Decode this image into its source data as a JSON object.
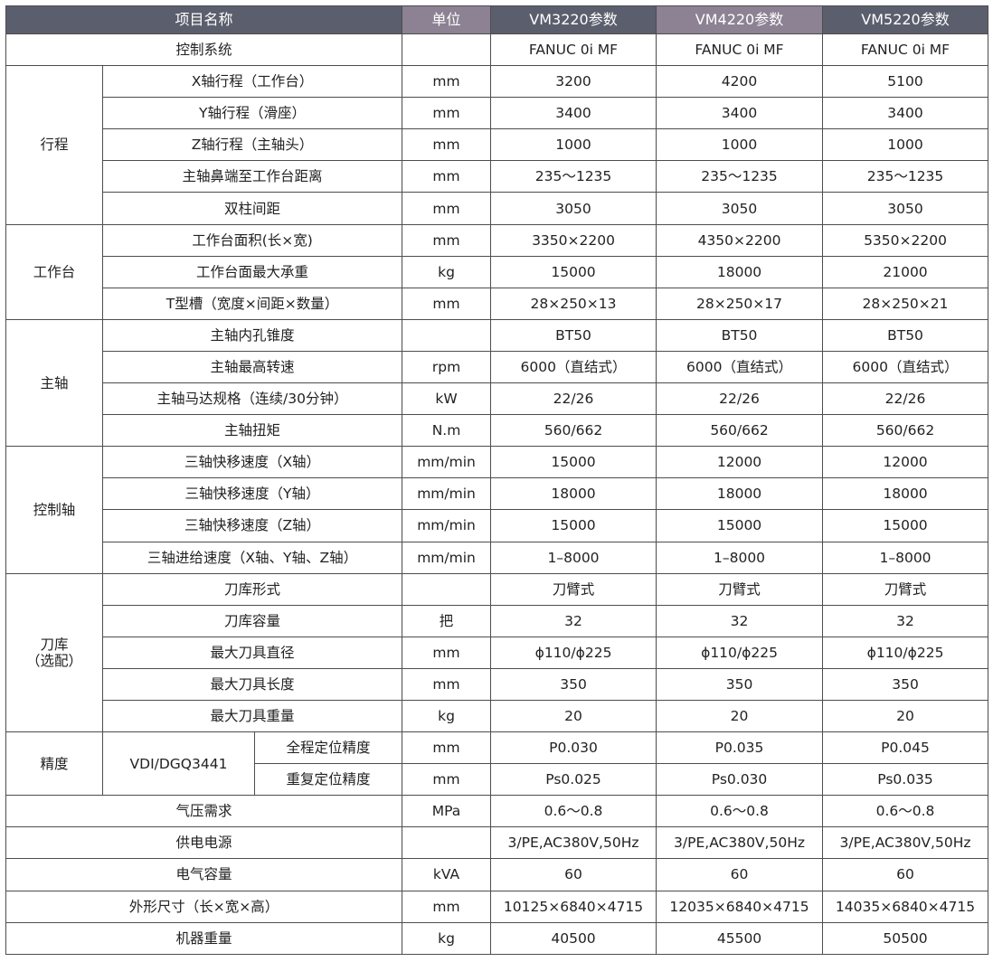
{
  "headers": {
    "name": "项目名称",
    "unit": "单位",
    "m1": "VM3220参数",
    "m2": "VM4220参数",
    "m3": "VM5220参数"
  },
  "control_system": {
    "label": "控制系统",
    "unit": "",
    "v": [
      "FANUC 0i MF",
      "FANUC 0i MF",
      "FANUC 0i MF"
    ]
  },
  "travel": {
    "label": "行程",
    "rows": [
      {
        "label": "X轴行程（工作台）",
        "unit": "mm",
        "v": [
          "3200",
          "4200",
          "5100"
        ]
      },
      {
        "label": "Y轴行程（滑座）",
        "unit": "mm",
        "v": [
          "3400",
          "3400",
          "3400"
        ]
      },
      {
        "label": "Z轴行程（主轴头）",
        "unit": "mm",
        "v": [
          "1000",
          "1000",
          "1000"
        ]
      },
      {
        "label": "主轴鼻端至工作台距离",
        "unit": "mm",
        "v": [
          "235～1235",
          "235～1235",
          "235～1235"
        ]
      },
      {
        "label": "双柱间距",
        "unit": "mm",
        "v": [
          "3050",
          "3050",
          "3050"
        ]
      }
    ]
  },
  "table_group": {
    "label": "工作台",
    "rows": [
      {
        "label": "工作台面积(长×宽)",
        "unit": "mm",
        "v": [
          "3350×2200",
          "4350×2200",
          "5350×2200"
        ]
      },
      {
        "label": "工作台面最大承重",
        "unit": "kg",
        "v": [
          "15000",
          "18000",
          "21000"
        ]
      },
      {
        "label": "T型槽（宽度×间距×数量）",
        "unit": "mm",
        "v": [
          "28×250×13",
          "28×250×17",
          "28×250×21"
        ]
      }
    ]
  },
  "spindle": {
    "label": "主轴",
    "rows": [
      {
        "label": "主轴内孔锥度",
        "unit": "",
        "v": [
          "BT50",
          "BT50",
          "BT50"
        ]
      },
      {
        "label": "主轴最高转速",
        "unit": "rpm",
        "v": [
          "6000（直结式）",
          "6000（直结式）",
          "6000（直结式）"
        ]
      },
      {
        "label": "主轴马达规格（连续/30分钟）",
        "unit": "kW",
        "v": [
          "22/26",
          "22/26",
          "22/26"
        ]
      },
      {
        "label": "主轴扭矩",
        "unit": "N.m",
        "v": [
          "560/662",
          "560/662",
          "560/662"
        ]
      }
    ]
  },
  "axes": {
    "label": "控制轴",
    "rows": [
      {
        "label": "三轴快移速度（X轴）",
        "unit": "mm/min",
        "v": [
          "15000",
          "12000",
          "12000"
        ]
      },
      {
        "label": "三轴快移速度（Y轴）",
        "unit": "mm/min",
        "v": [
          "18000",
          "18000",
          "18000"
        ]
      },
      {
        "label": "三轴快移速度（Z轴）",
        "unit": "mm/min",
        "v": [
          "15000",
          "15000",
          "15000"
        ]
      },
      {
        "label": "三轴进给速度（X轴、Y轴、Z轴）",
        "unit": "mm/min",
        "v": [
          "1–8000",
          "1–8000",
          "1–8000"
        ]
      }
    ]
  },
  "magazine": {
    "label_line1": "刀库",
    "label_line2": "（选配）",
    "rows": [
      {
        "label": "刀库形式",
        "unit": "",
        "v": [
          "刀臂式",
          "刀臂式",
          "刀臂式"
        ]
      },
      {
        "label": "刀库容量",
        "unit": "把",
        "v": [
          "32",
          "32",
          "32"
        ]
      },
      {
        "label": "最大刀具直径",
        "unit": "mm",
        "v": [
          "ϕ110/ϕ225",
          "ϕ110/ϕ225",
          "ϕ110/ϕ225"
        ]
      },
      {
        "label": "最大刀具长度",
        "unit": "mm",
        "v": [
          "350",
          "350",
          "350"
        ]
      },
      {
        "label": "最大刀具重量",
        "unit": "kg",
        "v": [
          "20",
          "20",
          "20"
        ]
      }
    ]
  },
  "precision": {
    "label": "精度",
    "standard": "VDI/DGQ3441",
    "rows": [
      {
        "label": "全程定位精度",
        "unit": "mm",
        "v": [
          "P0.030",
          "P0.035",
          "P0.045"
        ]
      },
      {
        "label": "重复定位精度",
        "unit": "mm",
        "v": [
          "Ps0.025",
          "Ps0.030",
          "Ps0.035"
        ]
      }
    ]
  },
  "misc": [
    {
      "label": "气压需求",
      "unit": "MPa",
      "v": [
        "0.6～0.8",
        "0.6～0.8",
        "0.6～0.8"
      ]
    },
    {
      "label": "供电电源",
      "unit": "",
      "v": [
        "3/PE,AC380V,50Hz",
        "3/PE,AC380V,50Hz",
        "3/PE,AC380V,50Hz"
      ]
    },
    {
      "label": "电气容量",
      "unit": "kVA",
      "v": [
        "60",
        "60",
        "60"
      ]
    },
    {
      "label": "外形尺寸（长×宽×高）",
      "unit": "mm",
      "v": [
        "10125×6840×4715",
        "12035×6840×4715",
        "14035×6840×4715"
      ]
    },
    {
      "label": "机器重量",
      "unit": "kg",
      "v": [
        "40500",
        "45500",
        "50500"
      ]
    }
  ],
  "colors": {
    "header_bg": "#5b5e6d",
    "header_highlight_bg": "#8c8293",
    "border": "#4d4d4d",
    "text": "#222222"
  }
}
